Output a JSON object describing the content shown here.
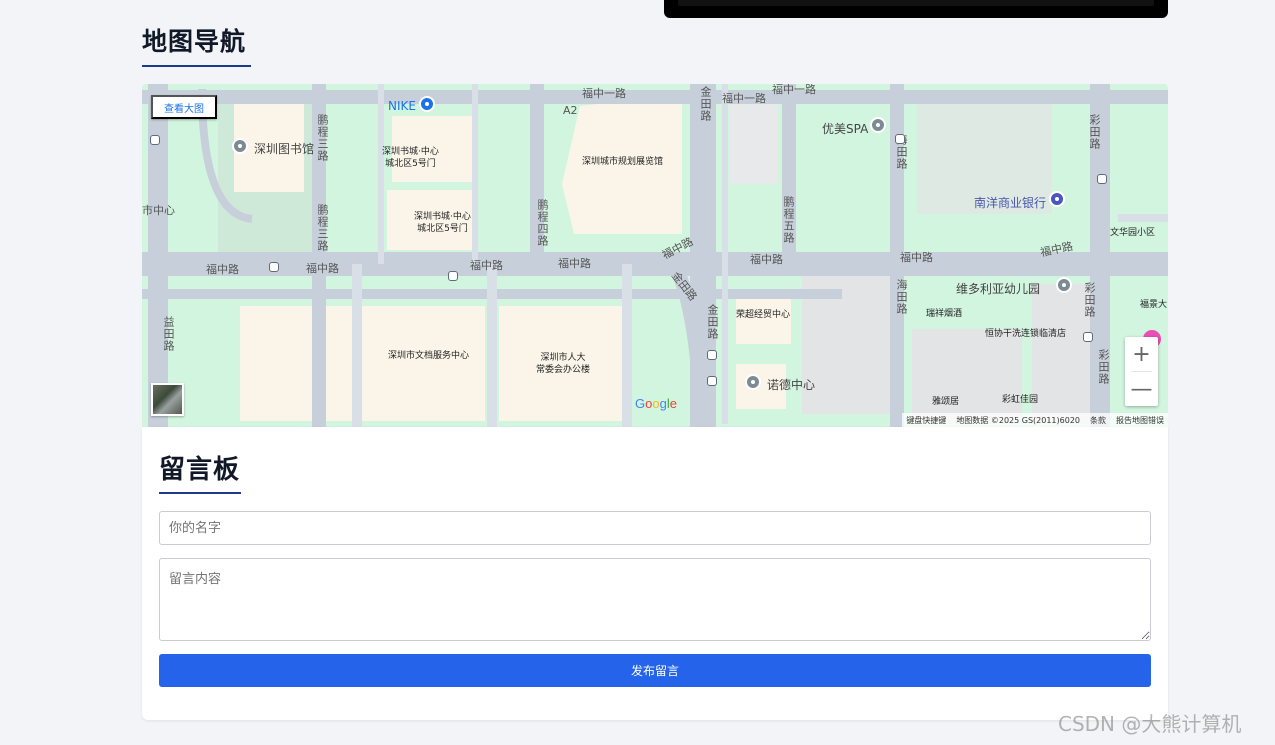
{
  "page": {
    "map_section_title": "地图导航",
    "guestbook_title": "留言板",
    "watermark": "CSDN @大熊计算机"
  },
  "map": {
    "view_large_label": "查看大图",
    "zoom_in": "+",
    "zoom_out": "—",
    "google_letters": [
      "G",
      "o",
      "o",
      "g",
      "l",
      "e"
    ],
    "attribution": [
      "键盘快捷键",
      "地图数据 ©2025 GS(2011)6020",
      "条款",
      "报告地图错误"
    ],
    "roads": {
      "fuzhong_yi": "福中一路",
      "fuzhong_yi_2": "福中一路",
      "fuzhong_yi_3": "福中一路",
      "a2": "A2",
      "fuzhong_1": "福中路",
      "fuzhong_2": "福中路",
      "fuzhong_3": "福中路",
      "fuzhong_4": "福中路",
      "fuzhong_5": "福中路",
      "fuzhong_6": "福中路",
      "fuzhong_7": "福中路",
      "fuzhong_8": "福中路",
      "pengcheng_san": "鹏程三路",
      "pengcheng_san_2": "鹏程三路",
      "pengcheng_si": "鹏程四路",
      "pengcheng_wu": "鹏程五路",
      "jintian_1": "金田路",
      "jintian_2": "金田路",
      "jintian_3": "金田路",
      "haitian_1": "海田路",
      "haitian_2": "海田路",
      "caitian_1": "彩田路",
      "caitian_2": "彩田路",
      "caitian_3": "彩田路",
      "yitian": "益田路",
      "shizhongxin": "市中心"
    },
    "places": {
      "nike": "NIKE",
      "library": "深圳图书馆",
      "bookcity_1": "深圳书城·中心\n城北区5号门",
      "bookcity_2": "深圳书城·中心\n城北区5号门",
      "planning_hall": "深圳城市规划展览馆",
      "youmei_spa": "优美SPA",
      "nanyang_bank": "南洋商业银行",
      "wenhua_garden": "文华园小区",
      "fujing": "福景大",
      "victoria_kindergarten": "维多利亚幼儿园",
      "ruixiang": "瑞祥烟酒",
      "hengxie": "恒协干洗连锁临清店",
      "rongchao": "荣超经贸中心",
      "nuode": "诺德中心",
      "yasong": "雅颂居",
      "caihong": "彩虹佳园",
      "archive_center": "深圳市文档服务中心",
      "renda": "深圳市人大\n常委会办公楼"
    }
  },
  "form": {
    "name_placeholder": "你的名字",
    "message_placeholder": "留言内容",
    "submit_label": "发布留言"
  }
}
